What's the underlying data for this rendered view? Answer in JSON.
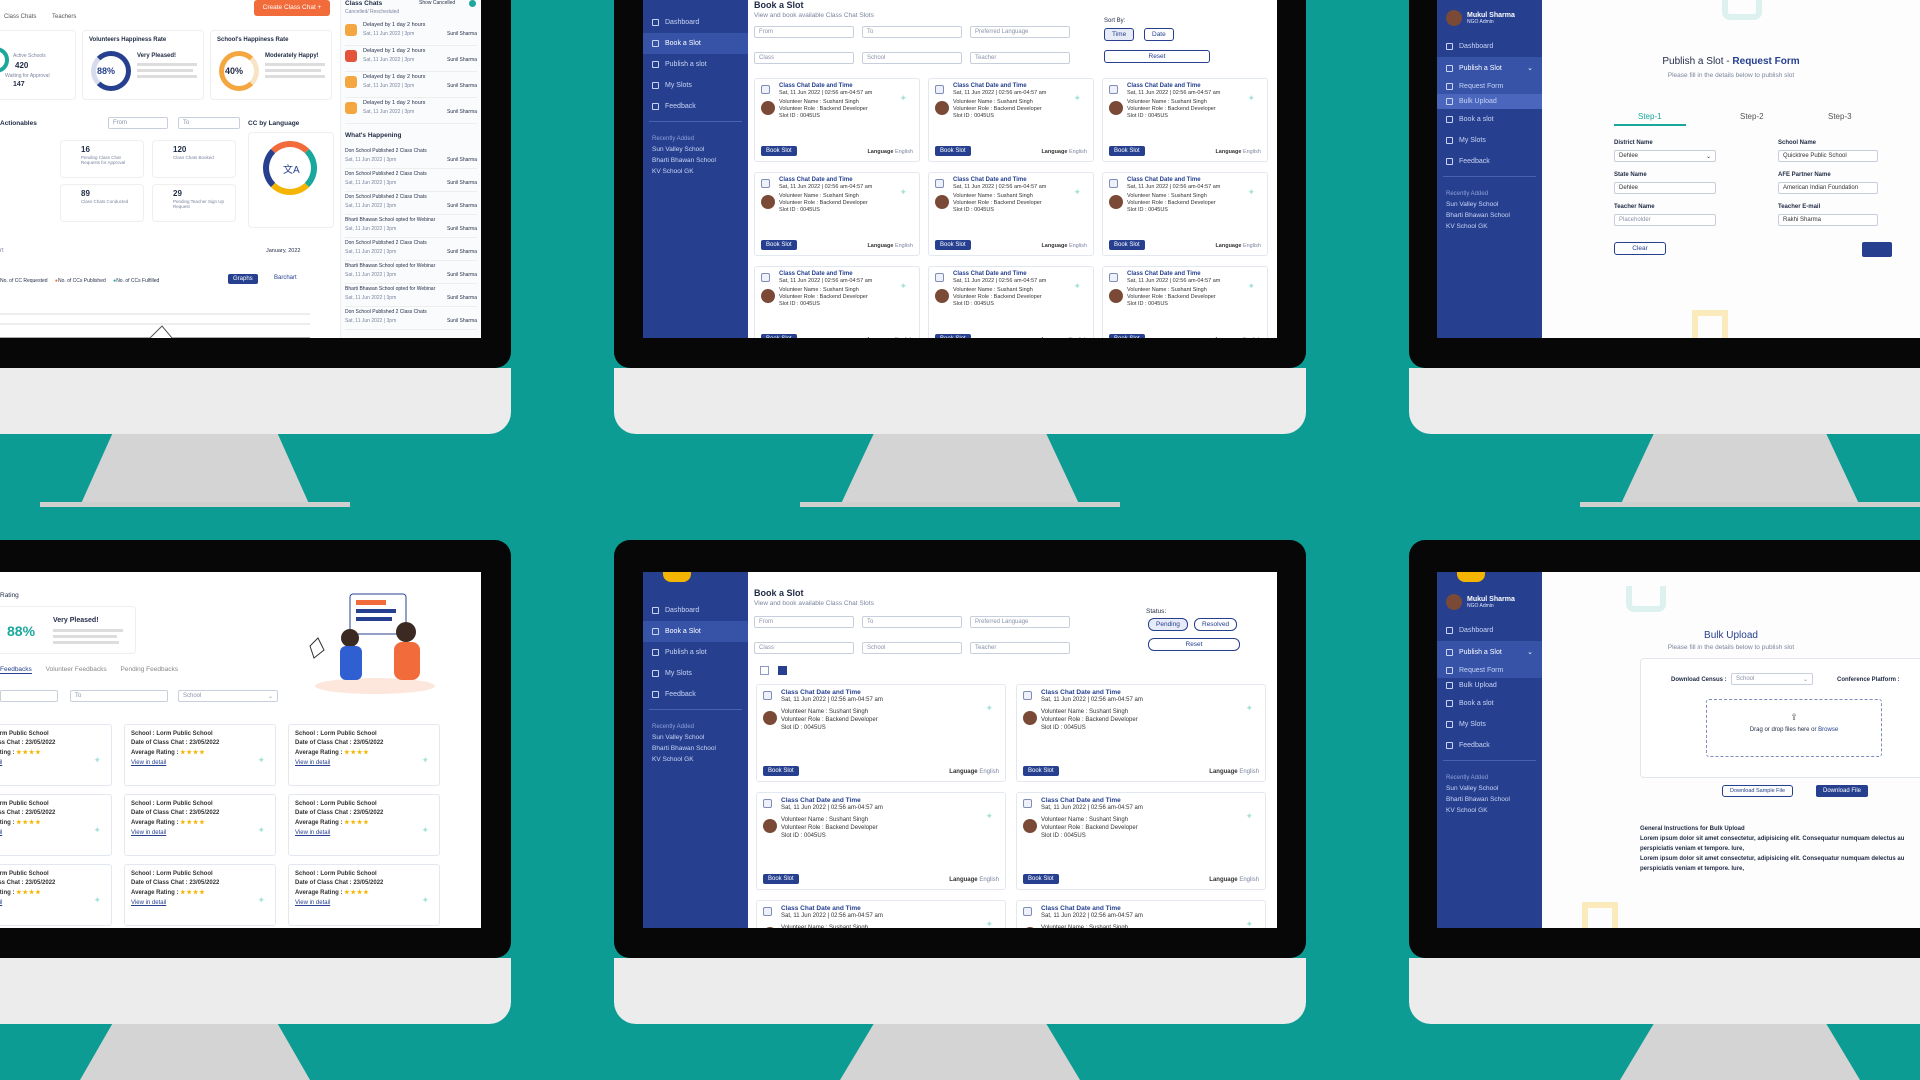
{
  "m1": {
    "title": "Class Chats",
    "sub": "Cancelled/ Rescheduled",
    "show_cancelled": "Show Cancelled",
    "create_btn": "Create Class Chat",
    "tabs": [
      "Class Chats",
      "Teachers"
    ],
    "active_schools": "Active Schools",
    "active_num": "420",
    "waiting": "Waiting for Approval",
    "waiting_num": "147",
    "vol_title": "Volunteers Happiness Rate",
    "vol_pct": "88%",
    "vol_label": "Very Pleased!",
    "sch_title": "School's Happiness Rate",
    "sch_pct": "40%",
    "sch_label": "Moderately Happy!",
    "actionables": "Actionables",
    "from": "From",
    "to": "To",
    "cc_lang": "CC by Language",
    "a1n": "16",
    "a1": "Pending Class Chat Requests for Approval",
    "a2n": "120",
    "a2": "Class Chats Booked",
    "a3n": "89",
    "a3": "Class Chats Conducted",
    "a4n": "29",
    "a4": "Pending Teacher Sign Up Request",
    "whats": "What's Happening",
    "events": [
      "Delayed by 1 day 2 hours",
      "Delayed by 1 day 2 hours",
      "Delayed by 1 day 2 hours",
      "Delayed by 1 day 2 hours"
    ],
    "feed": [
      "Don School Published 2 Class Chats",
      "Don School Published 2 Class Chats",
      "Don School Published 2 Class Chats",
      "Bharti Bhawan School opted for Webinar",
      "Don School Published 2 Class Chats",
      "Bharti Bhawan School opted for Webinar",
      "Bharti Bhawan School opted for Webinar",
      "Don School Published 2 Class Chats"
    ],
    "feed_date": "Sat, 11 Jun 2022 | 3pm",
    "feed_by": "Sunil Sharma",
    "month": "January, 2022",
    "legend": [
      "No. of CC Requested",
      "No. of CCs Published",
      "No. of CCs Fulfilled"
    ],
    "graph": "Graphs",
    "barchart": "Barchart"
  },
  "book": {
    "sidebar": [
      "Dashboard",
      "Book a Slot",
      "Publish a slot",
      "My Slots",
      "Feedback"
    ],
    "recent_hd": "Recently Added",
    "recent": [
      "Sun Valley School",
      "Bharti Bhawan School",
      "KV School GK"
    ],
    "title": "Book a Slot",
    "sub": "View and book available Class Chat Slots",
    "from": "From",
    "to": "To",
    "lang": "Preferred Language",
    "class": "Class",
    "school": "School",
    "teacher": "Teacher",
    "sort": "Sort By:",
    "time": "Time",
    "date": "Date",
    "reset": "Reset",
    "status": "Status:",
    "pending": "Pending",
    "resolved": "Resolved",
    "card_title": "Class Chat Date and Time",
    "card_date": "Sat, 11 Jun 2022 | 02:56 am-04:57 am",
    "vname": "Volunteer Name : Sushant Singh",
    "vrole": "Volunteer Role : Backend Developer",
    "slot": "Slot ID : 0045US",
    "book_btn": "Book Slot",
    "language": "Language",
    "lang_val": "English"
  },
  "pub": {
    "user": "Mukul Sharma",
    "org": "NGO Admin",
    "sidebar": [
      "Dashboard",
      "Publish a Slot",
      "Request Form",
      "Bulk Upload",
      "Book a slot",
      "My Slots",
      "Feedback"
    ],
    "recent_hd": "Recently Added",
    "recent": [
      "Sun Valley School",
      "Bharti Bhawan School",
      "KV School GK"
    ],
    "title_a": "Publish a Slot - ",
    "title_b": "Request Form",
    "sub": "Please fill in the details below to publish slot",
    "steps": [
      "Step-1",
      "Step-2",
      "Step-3"
    ],
    "district": "District Name",
    "district_val": "Dehlee",
    "school": "School Name",
    "school_val": "Quicktree Public School",
    "state": "State Name",
    "state_val": "Dehlee",
    "afe": "AFE Partner Name",
    "afe_val": "American Indian Foundation",
    "teacher": "Teacher Name",
    "teacher_ph": "Placeholder",
    "temail": "Teacher E-mail",
    "temail_val": "Rakhi Sharma",
    "clear": "Clear"
  },
  "fb": {
    "rating": "Rating",
    "pct": "88%",
    "pleased": "Very Pleased!",
    "tabs": [
      "Feedbacks",
      "Volunteer Feedbacks",
      "Pending Feedbacks"
    ],
    "to": "To",
    "school": "School",
    "school_lbl": "School : Lorm Public School",
    "date_lbl": "Date of Class Chat : 23/05/2022",
    "avg": "Average Rating :",
    "view": "View in detail"
  },
  "bulk": {
    "title": "Bulk Upload",
    "sub": "Please fill in the details below to publish slot",
    "census": "Download Census :",
    "census_val": "School",
    "conf": "Conference Platform :",
    "drag": "Drag or drop files here or",
    "browse": "Browse",
    "sample": "Download Sample File",
    "download": "Download File",
    "instr_hd": "General Instructions for Bulk Upload",
    "instr1": "Lorem ipsum dolor sit amet consectetur, adipisicing elit. Consequatur numquam delectus au",
    "instr2": "perspiciatis veniam et tempore. Iure,",
    "instr3": "Lorem ipsum dolor sit amet consectetur, adipisicing elit. Consequatur numquam delectus au",
    "instr4": "perspiciatis veniam et tempore. Iure,"
  }
}
